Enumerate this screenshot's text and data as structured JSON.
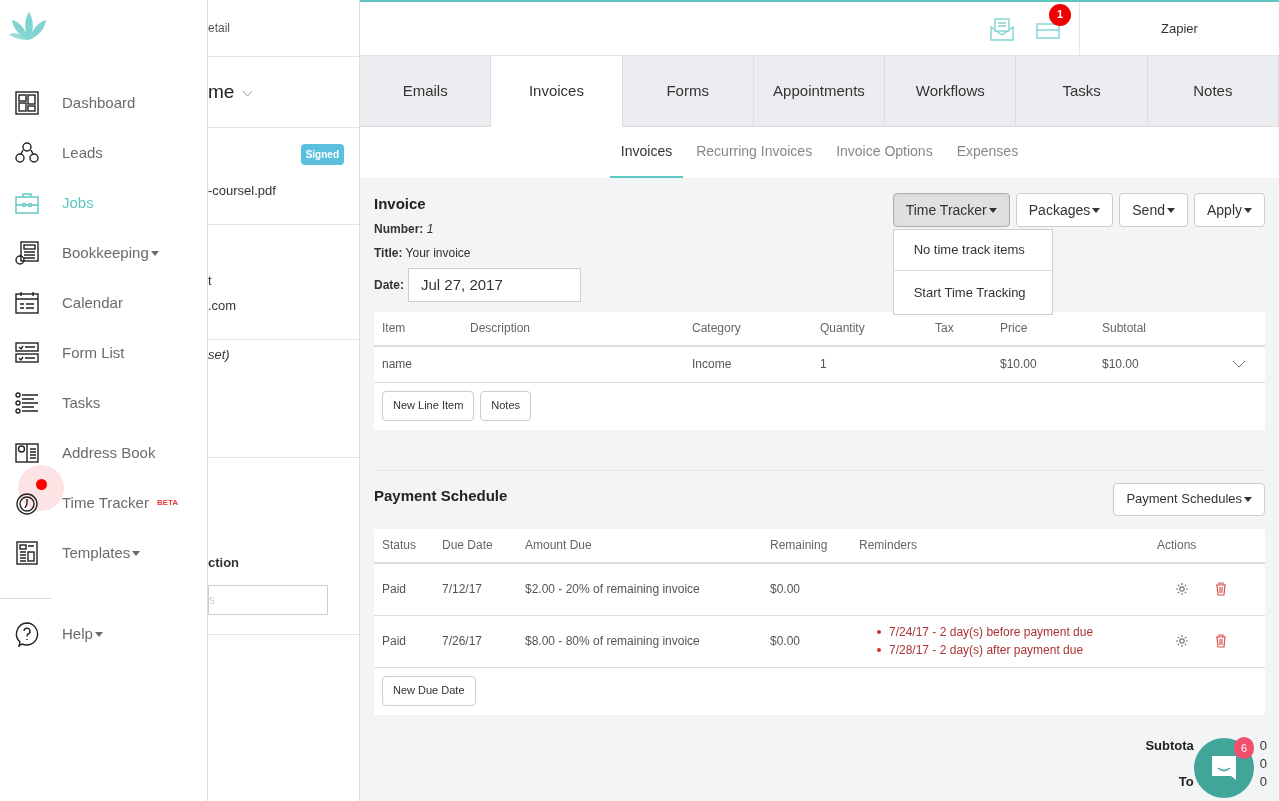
{
  "header": {
    "breadcrumb": "etail",
    "notification_count": "1",
    "account": "Zapier"
  },
  "sidebar": {
    "items": [
      {
        "label": "Dashboard",
        "selected": false,
        "menu": false
      },
      {
        "label": "Leads",
        "selected": false,
        "menu": false
      },
      {
        "label": "Jobs",
        "selected": true,
        "menu": false
      },
      {
        "label": "Bookkeeping",
        "selected": false,
        "menu": true
      },
      {
        "label": "Calendar",
        "selected": false,
        "menu": false
      },
      {
        "label": "Form List",
        "selected": false,
        "menu": false
      },
      {
        "label": "Tasks",
        "selected": false,
        "menu": false
      },
      {
        "label": "Address Book",
        "selected": false,
        "menu": false
      },
      {
        "label": "Time Tracker",
        "selected": false,
        "menu": false,
        "badge": "BETA",
        "alert": true
      },
      {
        "label": "Templates",
        "selected": false,
        "menu": true
      }
    ],
    "help": {
      "label": "Help",
      "menu": true
    }
  },
  "job_panel": {
    "title": "me",
    "status": "Signed",
    "file": "-coursel.pdf",
    "contact_lines": [
      "t",
      ".com"
    ],
    "package": "set)",
    "section": "ction",
    "search_placeholder": "s"
  },
  "tabs": [
    {
      "label": "Emails",
      "selected": false
    },
    {
      "label": "Invoices",
      "selected": true
    },
    {
      "label": "Forms",
      "selected": false
    },
    {
      "label": "Appointments",
      "selected": false
    },
    {
      "label": "Workflows",
      "selected": false
    },
    {
      "label": "Tasks",
      "selected": false
    },
    {
      "label": "Notes",
      "selected": false
    }
  ],
  "subtabs": [
    {
      "label": "Invoices",
      "selected": true
    },
    {
      "label": "Recurring Invoices",
      "selected": false
    },
    {
      "label": "Invoice Options",
      "selected": false
    },
    {
      "label": "Expenses",
      "selected": false
    }
  ],
  "invoice": {
    "heading": "Invoice",
    "number_label": "Number:",
    "number": "1",
    "title_label": "Title:",
    "title": "Your invoice",
    "date_label": "Date:",
    "date": "Jul 27, 2017",
    "actions": [
      {
        "label": "Time Tracker",
        "open": true
      },
      {
        "label": "Packages",
        "open": false
      },
      {
        "label": "Send",
        "open": false
      },
      {
        "label": "Apply",
        "open": false
      }
    ],
    "menu_items": [
      "No time track items",
      "Start Time Tracking"
    ],
    "columns": [
      "Item",
      "Description",
      "Category",
      "Quantity",
      "Tax",
      "Price",
      "Subtotal"
    ],
    "rows": [
      [
        "name",
        "",
        "Income",
        "1",
        "",
        "$10.00",
        "$10.00"
      ]
    ],
    "buttons": [
      "New Line Item",
      "Notes"
    ]
  },
  "payment": {
    "heading": "Payment Schedule",
    "menu_button": "Payment Schedules",
    "columns": [
      "Status",
      "Due Date",
      "Amount Due",
      "Remaining",
      "Reminders",
      "Actions"
    ],
    "rows": [
      {
        "status": "Paid",
        "due": "7/12/17",
        "amount": "$2.00 - 20% of remaining invoice",
        "remaining": "$0.00",
        "reminders": []
      },
      {
        "status": "Paid",
        "due": "7/26/17",
        "amount": "$8.00 - 80% of remaining invoice",
        "remaining": "$0.00",
        "reminders": [
          "7/24/17 - 2 day(s) before payment due",
          "7/28/17 - 2 day(s) after payment due"
        ]
      }
    ],
    "button": "New Due Date"
  },
  "totals": [
    {
      "label": "Subtota",
      "value": "0"
    },
    {
      "value": "0"
    },
    {
      "label": "To",
      "value": "0"
    }
  ],
  "chat": {
    "count": "6"
  }
}
